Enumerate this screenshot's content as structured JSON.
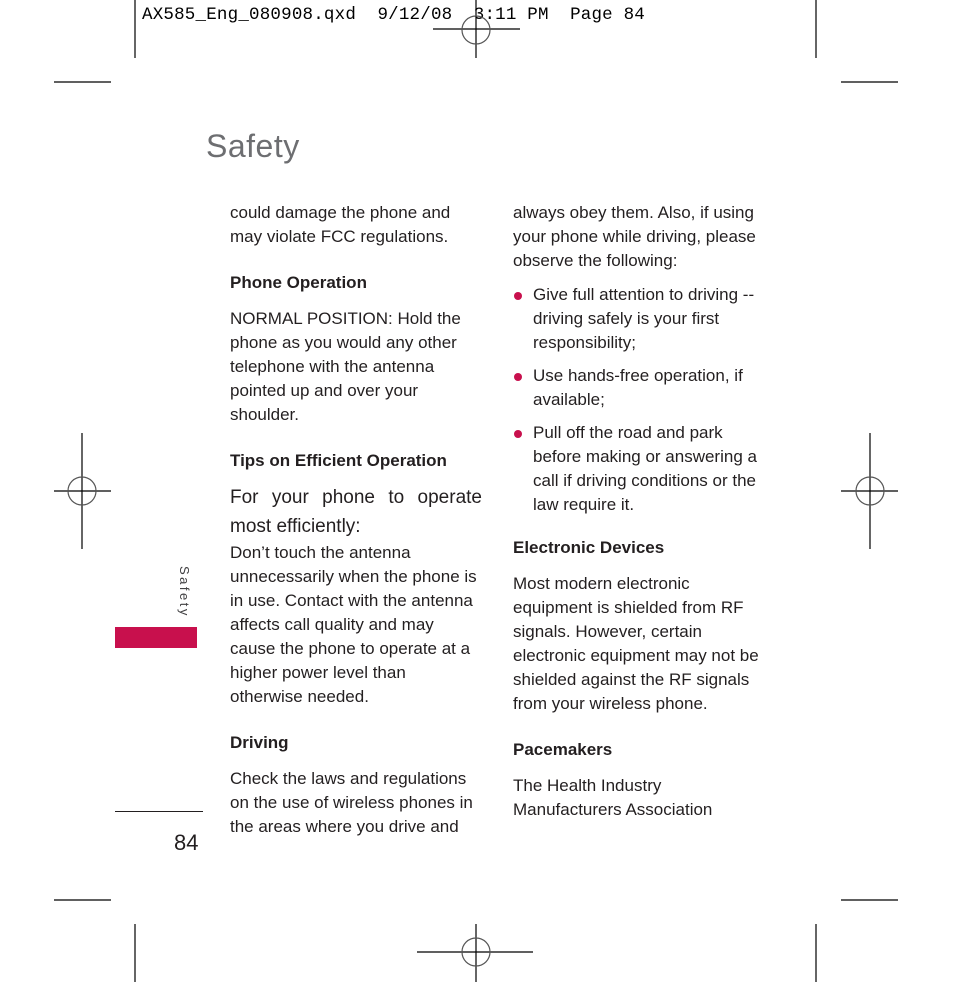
{
  "slug_line": "AX585_Eng_080908.qxd  9/12/08  3:11 PM  Page 84",
  "page": {
    "title": "Safety",
    "side_tab_label": "Safety",
    "page_number": "84",
    "accent_color": "#c8104d"
  },
  "left_column": {
    "intro": "could damage the phone and may violate FCC regulations.",
    "phone_operation": {
      "heading": "Phone Operation",
      "body": "NORMAL POSITION: Hold the phone as you would any other telephone with the antenna pointed up and over your shoulder."
    },
    "tips": {
      "heading": "Tips on Efficient Operation",
      "lead": "For your phone to operate most efficiently:",
      "body": "Don’t touch the antenna unnecessarily when the phone is in use. Contact with the antenna affects call quality and may cause the phone to operate at a higher power level than otherwise needed."
    },
    "driving": {
      "heading": "Driving",
      "body": "Check the laws and regulations on the use of wireless phones in the areas where you drive and"
    }
  },
  "right_column": {
    "intro": "always obey them. Also, if using your phone while driving, please observe the following:",
    "bullets": [
      "Give full attention to driving -- driving safely is your first responsibility;",
      "Use hands-free operation, if available;",
      "Pull off the road and park before making or answering a call if driving conditions or the law require it."
    ],
    "electronic_devices": {
      "heading": "Electronic Devices",
      "body": "Most modern electronic equipment is shielded from RF signals. However, certain electronic equipment may not be shielded against the RF signals from your wireless phone."
    },
    "pacemakers": {
      "heading": "Pacemakers",
      "body": "The Health Industry Manufacturers Association"
    }
  }
}
